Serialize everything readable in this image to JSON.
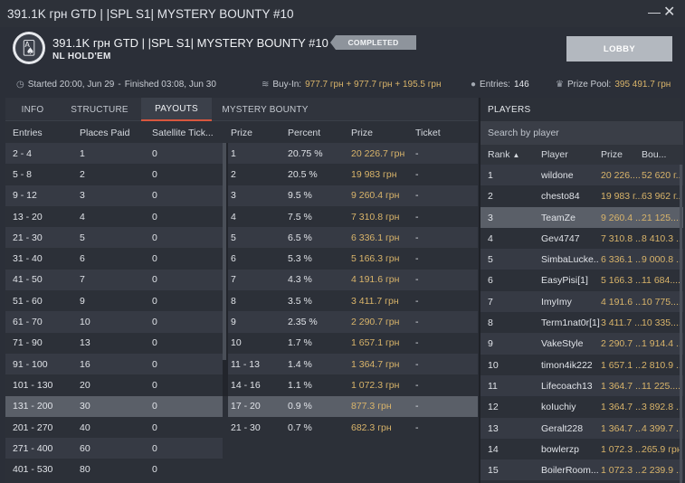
{
  "window": {
    "title": "391.1K грн GTD | |SPL S1| MYSTERY BOUNTY  #10"
  },
  "header": {
    "title": "391.1K грн GTD | |SPL S1| MYSTERY BOUNTY  #10",
    "game": "NL HOLD'EM",
    "status": "COMPLETED",
    "lobby_label": "LOBBY"
  },
  "info": {
    "started": "Started 20:00, Jun 29",
    "sep": "-",
    "finished": "Finished 03:08, Jun 30",
    "buyin_label": "Buy-In:",
    "buyin_value": "977.7 грн + 977.7 грн + 195.5 грн",
    "entries_label": "Entries:",
    "entries_value": "146",
    "prize_label": "Prize Pool:",
    "prize_value": "395 491.7 грн"
  },
  "tabs": [
    "INFO",
    "STRUCTURE",
    "PAYOUTS",
    "MYSTERY BOUNTY"
  ],
  "payouts_left": {
    "headers": [
      "Entries",
      "Places Paid",
      "Satellite Tick..."
    ],
    "rows": [
      [
        "2 - 4",
        "1",
        "0"
      ],
      [
        "5 - 8",
        "2",
        "0"
      ],
      [
        "9 - 12",
        "3",
        "0"
      ],
      [
        "13 - 20",
        "4",
        "0"
      ],
      [
        "21 - 30",
        "5",
        "0"
      ],
      [
        "31 - 40",
        "6",
        "0"
      ],
      [
        "41 - 50",
        "7",
        "0"
      ],
      [
        "51 - 60",
        "9",
        "0"
      ],
      [
        "61 - 70",
        "10",
        "0"
      ],
      [
        "71 - 90",
        "13",
        "0"
      ],
      [
        "91 - 100",
        "16",
        "0"
      ],
      [
        "101 - 130",
        "20",
        "0"
      ],
      [
        "131 - 200",
        "30",
        "0"
      ],
      [
        "201 - 270",
        "40",
        "0"
      ],
      [
        "271 - 400",
        "60",
        "0"
      ],
      [
        "401 - 530",
        "80",
        "0"
      ]
    ]
  },
  "payouts_right": {
    "headers": [
      "Prize",
      "Percent",
      "Prize",
      "Ticket"
    ],
    "rows": [
      [
        "1",
        "20.75 %",
        "20 226.7 грн",
        "-"
      ],
      [
        "2",
        "20.5 %",
        "19 983 грн",
        "-"
      ],
      [
        "3",
        "9.5 %",
        "9 260.4 грн",
        "-"
      ],
      [
        "4",
        "7.5 %",
        "7 310.8 грн",
        "-"
      ],
      [
        "5",
        "6.5 %",
        "6 336.1 грн",
        "-"
      ],
      [
        "6",
        "5.3 %",
        "5 166.3 грн",
        "-"
      ],
      [
        "7",
        "4.3 %",
        "4 191.6 грн",
        "-"
      ],
      [
        "8",
        "3.5 %",
        "3 411.7 грн",
        "-"
      ],
      [
        "9",
        "2.35 %",
        "2 290.7 грн",
        "-"
      ],
      [
        "10",
        "1.7 %",
        "1 657.1 грн",
        "-"
      ],
      [
        "11 - 13",
        "1.4 %",
        "1 364.7 грн",
        "-"
      ],
      [
        "14 - 16",
        "1.1 %",
        "1 072.3 грн",
        "-"
      ],
      [
        "17 - 20",
        "0.9 %",
        "877.3 грн",
        "-"
      ],
      [
        "21 - 30",
        "0.7 %",
        "682.3 грн",
        "-"
      ]
    ]
  },
  "players": {
    "title": "PLAYERS",
    "search_placeholder": "Search by player",
    "headers": [
      "Rank",
      "Player",
      "Prize",
      "Bou..."
    ],
    "sort_indicator": "▲",
    "rows": [
      [
        "1",
        "wildone",
        "20 226....",
        "52 620 г..."
      ],
      [
        "2",
        "chesto84",
        "19 983 г...",
        "63 962 г..."
      ],
      [
        "3",
        "TeamZe",
        "9 260.4 ...",
        "21 125...."
      ],
      [
        "4",
        "Gev4747",
        "7 310.8 ...",
        "8 410.3 ..."
      ],
      [
        "5",
        "SimbaLucke...",
        "6 336.1 ...",
        "9 000.8 ..."
      ],
      [
        "6",
        "EasyPisi[1]",
        "5 166.3 ...",
        "11 684...."
      ],
      [
        "7",
        "ImyImy",
        "4 191.6 ...",
        "10 775...."
      ],
      [
        "8",
        "Term1nat0r[1]",
        "3 411.7 ...",
        "10 335...."
      ],
      [
        "9",
        "VakeStyle",
        "2 290.7 ...",
        "1 914.4 ..."
      ],
      [
        "10",
        "timon4ik222",
        "1 657.1 ...",
        "2 810.9 ..."
      ],
      [
        "11",
        "Lifecoach13",
        "1 364.7 ...",
        "11 225...."
      ],
      [
        "12",
        "koIuchiy",
        "1 364.7 ...",
        "3 892.8 ..."
      ],
      [
        "13",
        "Geralt228",
        "1 364.7 ...",
        "4 399.7 ..."
      ],
      [
        "14",
        "bowlerzp",
        "1 072.3 ...",
        "265.9 грн"
      ],
      [
        "15",
        "BoilerRoom...",
        "1 072.3 ...",
        "2 239.9 ..."
      ]
    ]
  }
}
